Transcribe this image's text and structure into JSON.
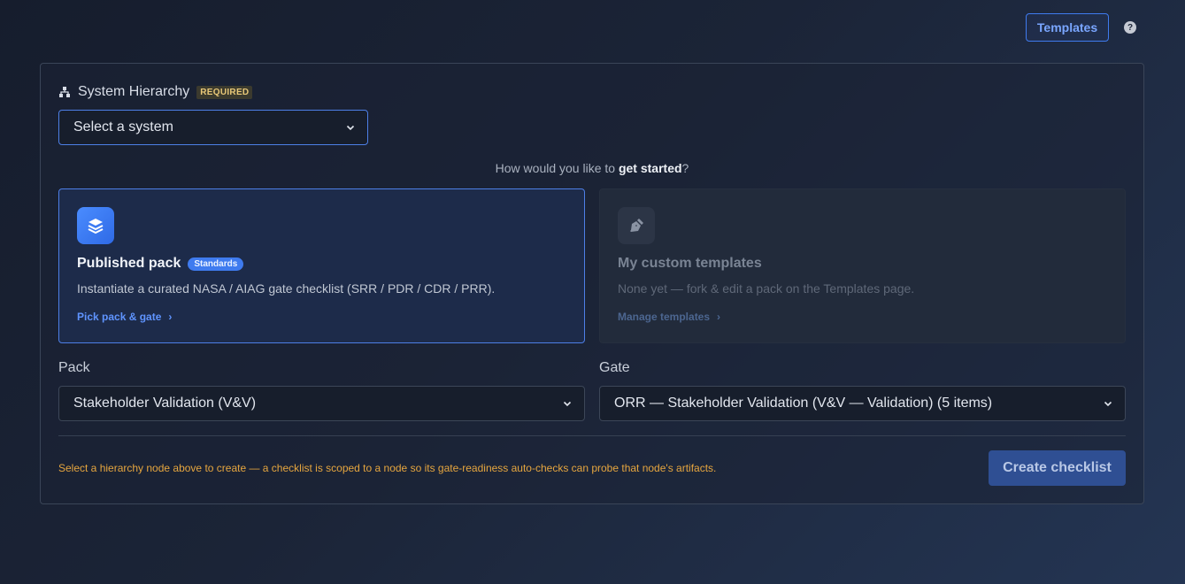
{
  "header": {
    "templates_label": "Templates",
    "help_glyph": "?"
  },
  "hierarchy": {
    "label": "System Hierarchy",
    "required_badge": "REQUIRED",
    "select_value": "Select a system"
  },
  "prompt": {
    "prefix": "How would you like to ",
    "bold": "get started",
    "suffix": "?"
  },
  "cards": {
    "published": {
      "title": "Published pack",
      "badge": "Standards",
      "description": "Instantiate a curated NASA / AIAG gate checklist (SRR / PDR / CDR / PRR).",
      "link": "Pick pack & gate",
      "icon": "layers-icon"
    },
    "custom": {
      "title": "My custom templates",
      "description": "None yet — fork & edit a pack on the Templates page.",
      "link": "Manage templates",
      "icon": "pen-nib-icon"
    }
  },
  "pack": {
    "label": "Pack",
    "value": "Stakeholder Validation (V&V)"
  },
  "gate": {
    "label": "Gate",
    "value": "ORR — Stakeholder Validation (V&V — Validation) (5 items)"
  },
  "footer": {
    "warning": "Select a hierarchy node above to create — a checklist is scoped to a node so its gate-readiness auto-checks can probe that node's artifacts.",
    "create_label": "Create checklist"
  },
  "colors": {
    "accent": "#3f7bef",
    "warning": "#e6a63f",
    "badge_required_text": "#e8c878"
  }
}
